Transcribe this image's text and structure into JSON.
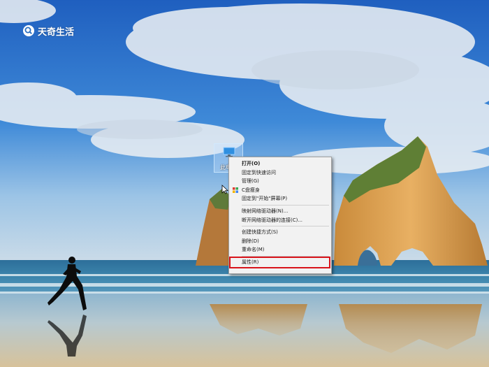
{
  "watermark": {
    "text": "天奇生活",
    "icon": "search-logo-icon"
  },
  "desktop": {
    "icon_label": "此电脑",
    "icon": "computer-monitor-icon"
  },
  "context_menu": {
    "items": [
      {
        "label": "打开(O)",
        "bold": true
      },
      {
        "label": "固定到快速访问"
      },
      {
        "label": "管理(G)"
      },
      {
        "label": "C盘瘦身",
        "icon": "app-grid-icon"
      },
      {
        "label": "固定到\"开始\"屏幕(P)"
      },
      {
        "label": "映射网络驱动器(N)..."
      },
      {
        "label": "断开网络驱动器的连接(C)..."
      },
      {
        "label": "创建快捷方式(S)"
      },
      {
        "label": "删除(D)"
      },
      {
        "label": "重命名(M)"
      },
      {
        "label": "属性(R)",
        "highlighted": true
      }
    ]
  },
  "colors": {
    "highlight_border": "#d9141b",
    "menu_bg": "#f2f2f2"
  }
}
